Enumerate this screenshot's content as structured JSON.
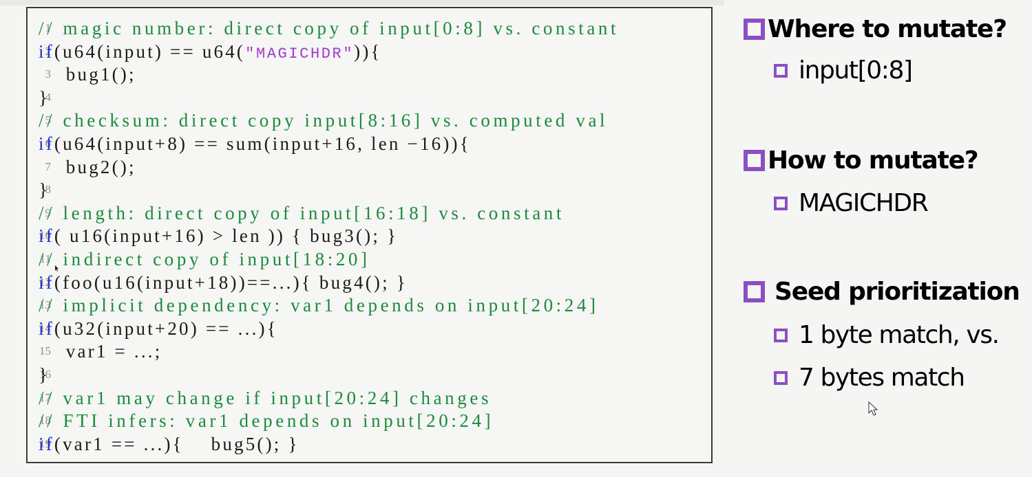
{
  "code": {
    "lines": [
      {
        "num": "1",
        "tokens": [
          {
            "type": "comment",
            "text": "// magic number: direct copy of input[0:8] vs. constant"
          }
        ]
      },
      {
        "num": "2",
        "tokens": [
          {
            "type": "keyword",
            "text": "if"
          },
          {
            "type": "plain",
            "text": "(u64(input) == u64("
          },
          {
            "type": "string",
            "text": "\"MAGICHDR\""
          },
          {
            "type": "plain",
            "text": ")){"
          }
        ]
      },
      {
        "num": "3",
        "tokens": [
          {
            "type": "plain",
            "text": "    bug1();"
          }
        ]
      },
      {
        "num": "4",
        "tokens": [
          {
            "type": "plain",
            "text": "}"
          }
        ]
      },
      {
        "num": "5",
        "tokens": [
          {
            "type": "comment",
            "text": "// checksum: direct copy input[8:16] vs. computed val"
          }
        ]
      },
      {
        "num": "6",
        "tokens": [
          {
            "type": "keyword",
            "text": "if"
          },
          {
            "type": "plain",
            "text": "(u64(input+8) == sum(input+16, len −16)){"
          }
        ]
      },
      {
        "num": "7",
        "tokens": [
          {
            "type": "plain",
            "text": "    bug2();"
          }
        ]
      },
      {
        "num": "8",
        "tokens": [
          {
            "type": "plain",
            "text": "}"
          }
        ]
      },
      {
        "num": "9",
        "tokens": [
          {
            "type": "comment",
            "text": "// length: direct copy of input[16:18] vs. constant"
          }
        ]
      },
      {
        "num": "10",
        "tokens": [
          {
            "type": "keyword",
            "text": "if"
          },
          {
            "type": "plain",
            "text": "( u16(input+16) > len )) { bug3(); }"
          }
        ]
      },
      {
        "num": "11",
        "tokens": [
          {
            "type": "comment",
            "text": "// indirect copy of input[18:20]"
          }
        ]
      },
      {
        "num": "12",
        "tokens": [
          {
            "type": "keyword",
            "text": "if"
          },
          {
            "type": "plain",
            "text": "(foo(u16(input+18))==...){ bug4(); }"
          }
        ]
      },
      {
        "num": "13",
        "tokens": [
          {
            "type": "comment",
            "text": "// implicit dependency: var1 depends on input[20:24]"
          }
        ]
      },
      {
        "num": "14",
        "tokens": [
          {
            "type": "keyword",
            "text": "if"
          },
          {
            "type": "plain",
            "text": "(u32(input+20) == ...){"
          }
        ]
      },
      {
        "num": "15",
        "tokens": [
          {
            "type": "plain",
            "text": "    var1 = ...;"
          }
        ]
      },
      {
        "num": "16",
        "tokens": [
          {
            "type": "plain",
            "text": "}"
          }
        ]
      },
      {
        "num": "17",
        "tokens": [
          {
            "type": "comment",
            "text": "// var1 may change if input[20:24] changes"
          }
        ]
      },
      {
        "num": "18",
        "tokens": [
          {
            "type": "comment",
            "text": "// FTI infers: var1 depends on input[20:24]"
          }
        ]
      },
      {
        "num": "19",
        "tokens": [
          {
            "type": "keyword",
            "text": "if"
          },
          {
            "type": "plain",
            "text": "(var1 == ...){    bug5(); }"
          }
        ]
      }
    ]
  },
  "bullets": [
    {
      "heading": "Where to mutate?",
      "items": [
        "input[0:8]"
      ]
    },
    {
      "heading": "How to mutate?",
      "items": [
        "MAGICHDR"
      ]
    },
    {
      "heading": "Seed prioritization",
      "items": [
        "1 byte match, vs.",
        "7 bytes match"
      ]
    }
  ],
  "colors": {
    "comment": "#1c8a3c",
    "keyword": "#1f2fd0",
    "string": "#a03ccc",
    "bullet": "#8a4fc2",
    "line_number": "#8d8d8d"
  }
}
